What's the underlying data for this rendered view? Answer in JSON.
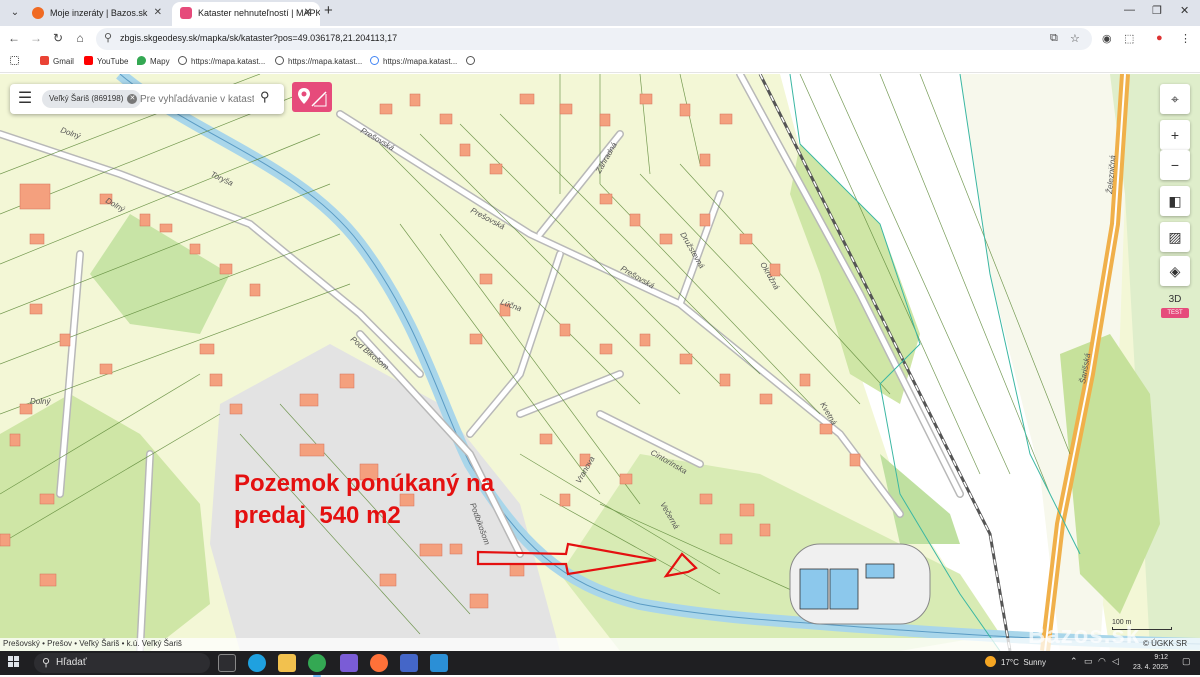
{
  "browser": {
    "tabs": [
      {
        "title": "Moje inzeráty | Bazos.sk",
        "active": false,
        "favicon_color": "#f06a22"
      },
      {
        "title": "Kataster nehnuteľností | MAPKA",
        "active": true,
        "favicon_color": "#e64b7b"
      }
    ],
    "url": "zbgis.skgeodesy.sk/mapka/sk/kataster?pos=49.036178,21.204113,17",
    "bookmarks": [
      {
        "label": "",
        "icon": "apps-grid-icon"
      },
      {
        "label": "Gmail",
        "icon": "gmail-icon"
      },
      {
        "label": "YouTube",
        "icon": "youtube-icon"
      },
      {
        "label": "Mapy",
        "icon": "maps-pin-icon"
      },
      {
        "label": "https://mapa.katast...",
        "icon": "globe-icon"
      },
      {
        "label": "https://mapa.katast...",
        "icon": "globe-icon"
      },
      {
        "label": "https://mapa.katast...",
        "icon": "google-icon"
      },
      {
        "label": "",
        "icon": "globe-icon"
      }
    ]
  },
  "map": {
    "cadastre_chip": "Veľký Šariš (869198)",
    "search_placeholder": "Pre vyhľadávanie v katastri",
    "controls": {
      "label_3d": "3D",
      "badge_test": "TEST"
    },
    "street_labels": [
      "Toryša",
      "Prešovská",
      "Prešovská",
      "Prešovská",
      "Dolný",
      "Dolný",
      "Dolný",
      "Pod Bikošom",
      "Podbikošom",
      "Cintorínska",
      "Vranova",
      "Večerná",
      "Družstevná",
      "Lúčna",
      "Okružná",
      "Záhradná",
      "Železničná",
      "Šarišská",
      "Kvetná"
    ],
    "annotation_line1": "Pozemok ponúkaný na",
    "annotation_line2": "predaj  540 m2",
    "scale_label": "100 m",
    "breadcrumb": "Prešovský • Prešov • Veľký Šariš • k.ú. Veľký Šariš",
    "copyright": "© ÚGKK SR",
    "watermark": "Bazos.sk",
    "colors": {
      "map_bg": "#f3f7d6",
      "building": "#f4a07e",
      "forest": "#cfe6a6",
      "river": "#a9d6ea",
      "annotation": "#e41010",
      "accent_pink": "#e64b7b"
    }
  },
  "taskbar": {
    "search_label": "Hľadať",
    "weather": "17°C  Sunny",
    "time": "9:12",
    "date": "23. 4. 2025"
  }
}
